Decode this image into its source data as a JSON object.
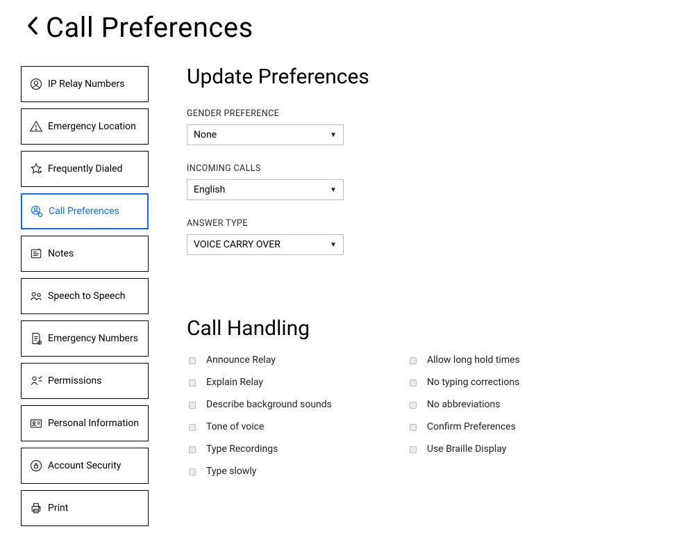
{
  "header": {
    "title": "Call Preferences"
  },
  "sidebar": {
    "items": [
      {
        "label": "IP Relay Numbers"
      },
      {
        "label": "Emergency Location"
      },
      {
        "label": "Frequently Dialed"
      },
      {
        "label": "Call Preferences"
      },
      {
        "label": "Notes"
      },
      {
        "label": "Speech to Speech"
      },
      {
        "label": "Emergency Numbers"
      },
      {
        "label": "Permissions"
      },
      {
        "label": "Personal Information"
      },
      {
        "label": "Account Security"
      },
      {
        "label": "Print"
      }
    ]
  },
  "preferences": {
    "section_title": "Update Preferences",
    "gender_label": "GENDER PREFERENCE",
    "gender_value": "None",
    "incoming_label": "INCOMING CALLS",
    "incoming_value": "English",
    "answer_label": "ANSWER TYPE",
    "answer_value": "VOICE CARRY OVER"
  },
  "call_handling": {
    "section_title": "Call Handling",
    "left": [
      {
        "label": "Announce Relay"
      },
      {
        "label": "Explain Relay"
      },
      {
        "label": "Describe background sounds"
      },
      {
        "label": "Tone of voice"
      },
      {
        "label": "Type Recordings"
      },
      {
        "label": "Type slowly"
      }
    ],
    "right": [
      {
        "label": "Allow long hold times"
      },
      {
        "label": "No typing corrections"
      },
      {
        "label": "No abbreviations"
      },
      {
        "label": "Confirm Preferences"
      },
      {
        "label": "Use Braille Display"
      }
    ]
  }
}
